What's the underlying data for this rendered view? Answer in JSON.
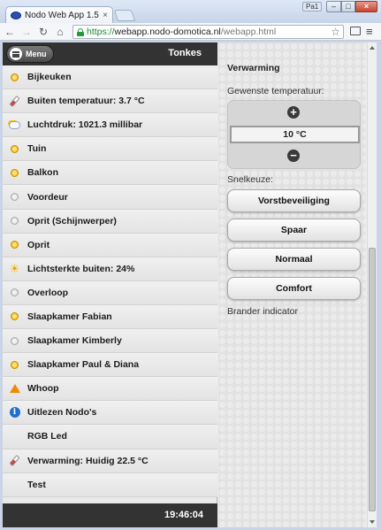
{
  "browser": {
    "tab_title": "Nodo Web App 1.5",
    "tab_close": "×",
    "user_badge": "Pa1",
    "url": {
      "secure": "https://",
      "host": "webapp.nodo-domotica.nl",
      "path": "/webapp.html"
    }
  },
  "header": {
    "menu_label": "Menu",
    "title": "Tonkes"
  },
  "devices": [
    {
      "label": "Bijkeuken",
      "icon": "bulb-on-icon"
    },
    {
      "label": "Buiten temperatuur: 3.7 °C",
      "icon": "thermometer-icon"
    },
    {
      "label": "Luchtdruk: 1021.3 millibar",
      "icon": "weather-icon"
    },
    {
      "label": "Tuin",
      "icon": "bulb-on-icon"
    },
    {
      "label": "Balkon",
      "icon": "bulb-on-icon"
    },
    {
      "label": "Voordeur",
      "icon": "bulb-off-icon"
    },
    {
      "label": "Oprit (Schijnwerper)",
      "icon": "bulb-off-icon"
    },
    {
      "label": "Oprit",
      "icon": "bulb-on-icon"
    },
    {
      "label": "Lichtsterkte buiten: 24%",
      "icon": "sun-icon"
    },
    {
      "label": "Overloop",
      "icon": "bulb-off-icon"
    },
    {
      "label": "Slaapkamer Fabian",
      "icon": "bulb-on-icon"
    },
    {
      "label": "Slaapkamer Kimberly",
      "icon": "bulb-off-icon"
    },
    {
      "label": "Slaapkamer Paul & Diana",
      "icon": "bulb-on-icon"
    },
    {
      "label": "Whoop",
      "icon": "alarm-icon"
    },
    {
      "label": "Uitlezen Nodo's",
      "icon": "info-icon"
    },
    {
      "label": "RGB Led",
      "icon": ""
    },
    {
      "label": "Verwarming: Huidig 22.5 °C",
      "icon": "thermometer-icon"
    },
    {
      "label": "Test",
      "icon": ""
    }
  ],
  "footer": {
    "time": "19:46:04"
  },
  "heating": {
    "title": "Verwarming",
    "desired_label": "Gewenste temperatuur:",
    "value": "10 °C",
    "plus": "+",
    "minus": "−",
    "quick_label": "Snelkeuze:",
    "presets": [
      "Vorstbeveiliging",
      "Spaar",
      "Normaal",
      "Comfort"
    ],
    "indicator_label": "Brander indicator"
  }
}
